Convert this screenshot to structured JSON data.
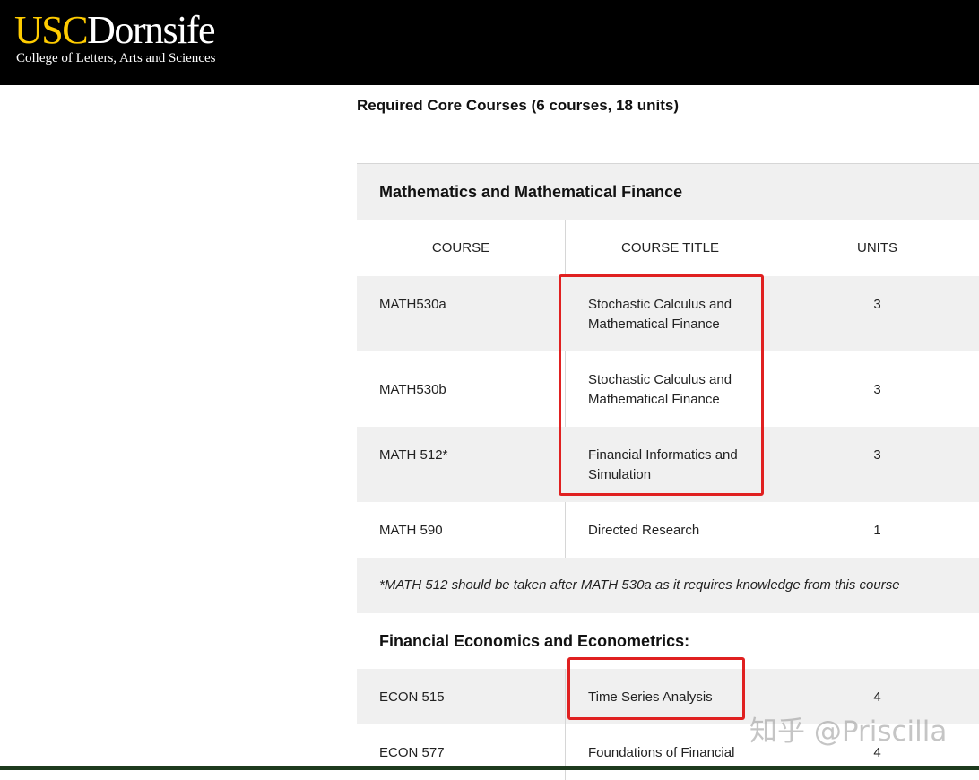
{
  "header": {
    "logo_usc": "USC",
    "logo_dornsife": "Dornsife",
    "logo_subtitle": "College of Letters, Arts and Sciences",
    "background_color": "#000000",
    "accent_color": "#FFCC00"
  },
  "page": {
    "heading": "Required Core Courses (6 courses, 18 units)"
  },
  "table": {
    "columns": [
      "COURSE",
      "COURSE TITLE",
      "UNITS"
    ],
    "groups": [
      {
        "title": "Mathematics and Mathematical Finance",
        "rows": [
          {
            "course": "MATH530a",
            "title": "Stochastic Calculus and Mathematical Finance",
            "units": "3"
          },
          {
            "course": "MATH530b",
            "title": "Stochastic Calculus and Mathematical Finance",
            "units": "3"
          },
          {
            "course": "MATH 512*",
            "title": "Financial Informatics and Simulation",
            "units": "3"
          },
          {
            "course": "MATH 590",
            "title": "Directed Research",
            "units": "1"
          }
        ],
        "note": "*MATH 512 should be taken after MATH 530a as it requires knowledge from this course"
      },
      {
        "title": "Financial Economics and Econometrics:",
        "rows": [
          {
            "course": "ECON 515",
            "title": "Time Series Analysis",
            "units": "4"
          },
          {
            "course": "ECON 577",
            "title": "Foundations of Financial",
            "units": "4"
          }
        ]
      }
    ]
  },
  "annotations": {
    "highlight_color": "#e02020"
  },
  "watermark": {
    "text": "知乎 @Priscilla"
  }
}
